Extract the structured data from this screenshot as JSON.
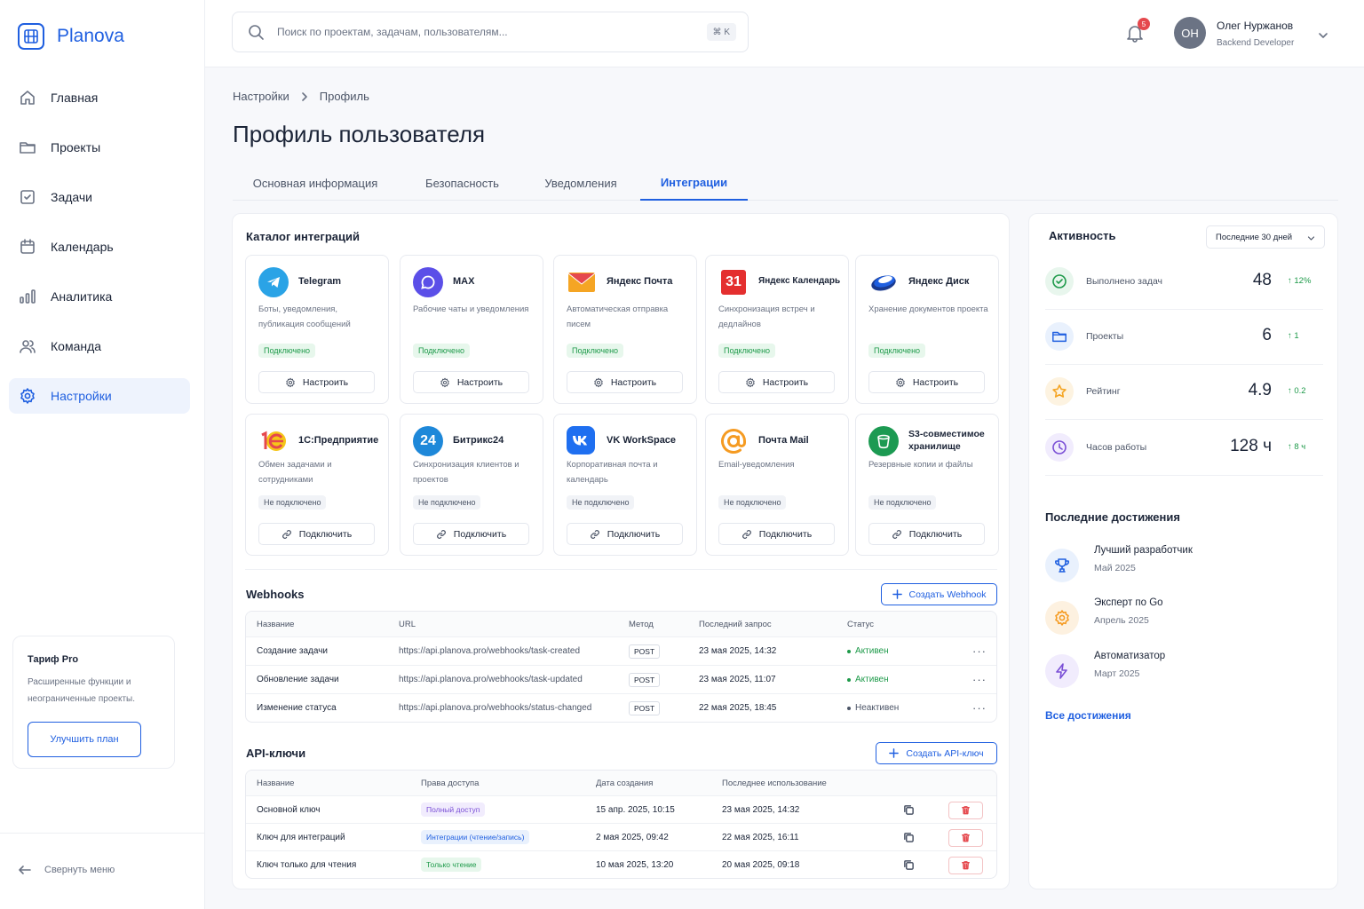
{
  "app": {
    "name": "Planova"
  },
  "sidebar": {
    "items": [
      {
        "label": "Главная",
        "icon": "home-icon"
      },
      {
        "label": "Проекты",
        "icon": "folder-icon"
      },
      {
        "label": "Задачи",
        "icon": "checkbox-icon"
      },
      {
        "label": "Календарь",
        "icon": "calendar-icon"
      },
      {
        "label": "Аналитика",
        "icon": "bar-chart-icon"
      },
      {
        "label": "Команда",
        "icon": "users-icon"
      },
      {
        "label": "Настройки",
        "icon": "gear-icon",
        "active": true
      }
    ],
    "plan": {
      "title": "Тариф Pro",
      "description": "Расширенные функции и неограниченные проекты.",
      "button": "Улучшить план"
    },
    "collapse": "Свернуть меню"
  },
  "topbar": {
    "search_placeholder": "Поиск по проектам, задачам, пользователям...",
    "shortcut": "⌘ K",
    "notifications_count": "5",
    "user": {
      "initials": "ОН",
      "name": "Олег Нуржанов",
      "role": "Backend Developer"
    }
  },
  "breadcrumbs": [
    "Настройки",
    "Профиль"
  ],
  "page_title": "Профиль пользователя",
  "tabs": [
    {
      "label": "Основная информация"
    },
    {
      "label": "Безопасность"
    },
    {
      "label": "Уведомления"
    },
    {
      "label": "Интеграции",
      "active": true
    }
  ],
  "catalog": {
    "title": "Каталог интеграций",
    "items": [
      {
        "name": "Telegram",
        "description": "Боты, уведомления, публикация сообщений",
        "status": "Подключено",
        "connected": true,
        "action": "Настроить",
        "icon": "telegram-icon",
        "color": "#2aa3e6"
      },
      {
        "name": "MAX",
        "description": "Рабочие чаты и уведомления",
        "status": "Подключено",
        "connected": true,
        "action": "Настроить",
        "icon": "max-chat-icon",
        "color": "#5b4fe8"
      },
      {
        "name": "Яндекс Почта",
        "description": "Автоматическая отправка писем",
        "status": "Подключено",
        "connected": true,
        "action": "Настроить",
        "icon": "yandex-mail-icon",
        "color": "#f5a524"
      },
      {
        "name": "Яндекс Календарь",
        "description": "Синхронизация встреч и дедлайнов",
        "status": "Подключено",
        "connected": true,
        "action": "Настроить",
        "icon": "yandex-calendar-icon",
        "color": "#e42f2f",
        "icon_text": "31"
      },
      {
        "name": "Яндекс Диск",
        "description": "Хранение документов проекта",
        "status": "Подключено",
        "connected": true,
        "action": "Настроить",
        "icon": "yandex-disk-icon",
        "color": "#1f5fe0"
      },
      {
        "name": "1С:Предприятие",
        "description": "Обмен задачами и сотрудниками",
        "status": "Не подключено",
        "connected": false,
        "action": "Подключить",
        "icon": "1c-icon",
        "color": "#f5c518"
      },
      {
        "name": "Битрикс24",
        "description": "Синхронизация клиентов и проектов",
        "status": "Не подключено",
        "connected": false,
        "action": "Подключить",
        "icon": "bitrix24-icon",
        "color": "#1e88d9",
        "icon_text": "24"
      },
      {
        "name": "VK WorkSpace",
        "description": "Корпоративная почта и календарь",
        "status": "Не подключено",
        "connected": false,
        "action": "Подключить",
        "icon": "vk-icon",
        "color": "#1f6ff0"
      },
      {
        "name": "Почта Mail",
        "description": "Email-уведомления",
        "status": "Не подключено",
        "connected": false,
        "action": "Подключить",
        "icon": "at-sign-icon",
        "color": "#f59b22"
      },
      {
        "name": "S3-совместимое хранилище",
        "description": "Резервные копии и файлы",
        "status": "Не подключено",
        "connected": false,
        "action": "Подключить",
        "icon": "bucket-icon",
        "color": "#1c9a52"
      }
    ]
  },
  "webhooks": {
    "title": "Webhooks",
    "create_label": "Создать Webhook",
    "columns": [
      "Название",
      "URL",
      "Метод",
      "Последний запрос",
      "Статус"
    ],
    "rows": [
      {
        "name": "Создание задачи",
        "url": "https://api.planova.pro/webhooks/task-created",
        "method": "POST",
        "last": "23 мая 2025, 14:32",
        "status": "Активен",
        "active": true
      },
      {
        "name": "Обновление задачи",
        "url": "https://api.planova.pro/webhooks/task-updated",
        "method": "POST",
        "last": "23 мая 2025, 11:07",
        "status": "Активен",
        "active": true
      },
      {
        "name": "Изменение статуса",
        "url": "https://api.planova.pro/webhooks/status-changed",
        "method": "POST",
        "last": "22 мая 2025, 18:45",
        "status": "Неактивен",
        "active": false
      }
    ]
  },
  "api_keys": {
    "title": "API-ключи",
    "create_label": "Создать API-ключ",
    "columns": [
      "Название",
      "Права доступа",
      "Дата создания",
      "Последнее использование"
    ],
    "rows": [
      {
        "name": "Основной ключ",
        "access": "Полный доступ",
        "access_bg": "#f1ecfd",
        "access_color": "#7a4fd6",
        "created": "15 апр. 2025, 10:15",
        "last_used": "23 мая 2025, 14:32"
      },
      {
        "name": "Ключ для интеграций",
        "access": "Интеграции (чтение/запись)",
        "access_bg": "#e9f1fd",
        "access_color": "#1f5fe0",
        "created": "2 мая 2025, 09:42",
        "last_used": "22 мая 2025, 16:11"
      },
      {
        "name": "Ключ только для чтения",
        "access": "Только чтение",
        "access_bg": "#e7f7ec",
        "access_color": "#1e9a4a",
        "created": "10 мая 2025, 13:20",
        "last_used": "20 мая 2025, 09:18"
      }
    ]
  },
  "activity": {
    "title": "Активность",
    "period": "Последние 30 дней",
    "stats": [
      {
        "label": "Выполнено задач",
        "value": "48",
        "delta": "↑ 12%",
        "icon": "check-circle-icon",
        "color": "#1e9a4a",
        "bg": "#e8f6ed"
      },
      {
        "label": "Проекты",
        "value": "6",
        "delta": "↑ 1",
        "icon": "folder-icon",
        "color": "#1f5fe0",
        "bg": "#e9f1fd"
      },
      {
        "label": "Рейтинг",
        "value": "4.9",
        "delta": "↑ 0.2",
        "icon": "star-icon",
        "color": "#f5a524",
        "bg": "#fdf3e1"
      },
      {
        "label": "Часов работы",
        "value": "128 ч",
        "delta": "↑ 8 ч",
        "icon": "clock-icon",
        "color": "#7a4fd6",
        "bg": "#f1ecfd"
      }
    ]
  },
  "achievements": {
    "title": "Последние достижения",
    "items": [
      {
        "name": "Лучший разработчик",
        "date": "Май 2025",
        "icon": "trophy-icon",
        "color": "#1f5fe0",
        "bg": "#e9f1fd"
      },
      {
        "name": "Эксперт по Go",
        "date": "Апрель 2025",
        "icon": "gear-badge-icon",
        "color": "#f59b22",
        "bg": "#fdf1e0"
      },
      {
        "name": "Автоматизатор",
        "date": "Март 2025",
        "icon": "lightning-icon",
        "color": "#7a4fd6",
        "bg": "#f1ecfd"
      }
    ],
    "all_label": "Все достижения"
  }
}
